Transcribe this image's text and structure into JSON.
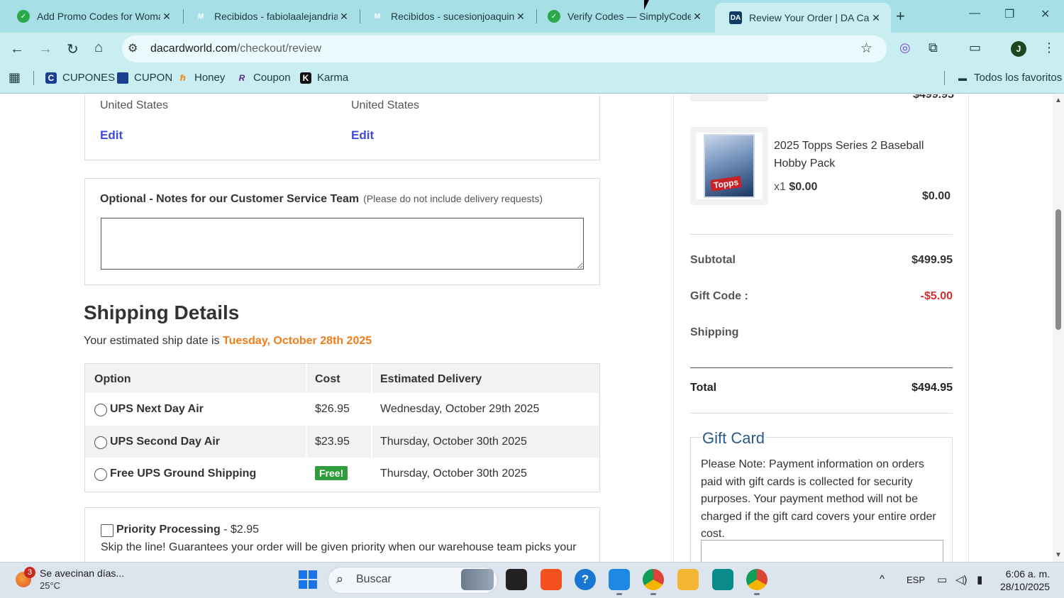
{
  "browser": {
    "tabs": [
      {
        "label": "Add Promo Codes for Woma",
        "icon": "simplycodes-icon"
      },
      {
        "label": "Recibidos - fabiolaalejandria",
        "icon": "gmail-icon"
      },
      {
        "label": "Recibidos - sucesionjoaquinh",
        "icon": "gmail-icon"
      },
      {
        "label": "Verify Codes — SimplyCodes",
        "icon": "simplycodes-icon"
      },
      {
        "label": "Review Your Order | DA Card",
        "icon": "da-icon",
        "active": true
      }
    ],
    "url_domain": "dacardworld.com",
    "url_path": "/checkout/review",
    "bookmarks": [
      {
        "label": "CUPONES"
      },
      {
        "label": "CUPON"
      },
      {
        "label": "Honey"
      },
      {
        "label": "Coupon"
      },
      {
        "label": "Karma"
      }
    ],
    "all_bookmarks": "Todos los favoritos",
    "profile_initial": "J",
    "tab_icon_texts": {
      "da": "DA",
      "gmail": "M"
    },
    "icon_glyphs": {
      "close": "✕",
      "new_tab": "+",
      "minimize": "—",
      "maximize": "❐",
      "back": "←",
      "forward": "→",
      "reload": "↻",
      "home": "⌂",
      "tune": "⚙",
      "star": "☆",
      "extension-ai": "◎",
      "puzzle": "⧉",
      "cast": "▭",
      "menu": "⋮",
      "apps-grid": "▦",
      "folder": "▬",
      "honey": "ℏ",
      "coupon": "R",
      "karma": "K",
      "cupones": "C"
    }
  },
  "addresses": {
    "billing_country": "United States",
    "shipping_country": "United States",
    "edit_label": "Edit"
  },
  "notes": {
    "title": "Optional - Notes for our Customer Service Team",
    "hint": "(Please do not include delivery requests)",
    "value": ""
  },
  "shipping": {
    "title": "Shipping Details",
    "estimate_prefix": "Your estimated ship date is",
    "estimate_date": "Tuesday, October 28th 2025",
    "headers": [
      "Option",
      "Cost",
      "Estimated Delivery"
    ],
    "options": [
      {
        "name": "UPS Next Day Air",
        "cost": "$26.95",
        "delivery": "Wednesday, October 29th 2025"
      },
      {
        "name": "UPS Second Day Air",
        "cost": "$23.95",
        "delivery": "Thursday, October 30th 2025"
      },
      {
        "name": "Free UPS Ground Shipping",
        "cost": "Free!",
        "delivery": "Thursday, October 30th 2025"
      }
    ]
  },
  "priority": {
    "title": "Priority Processing",
    "price": "- $2.95",
    "desc": "Skip the line! Guarantees your order will be given priority when our warehouse team picks your"
  },
  "order": {
    "prev_item_price": "$499.95",
    "item": {
      "name": "2025 Topps Series 2 Baseball Hobby Pack",
      "qty": "x1",
      "unit_price": "$0.00",
      "price": "$0.00",
      "logo_text": "Topps"
    },
    "summary": {
      "subtotal_label": "Subtotal",
      "subtotal": "$499.95",
      "gift_code_label": "Gift Code :",
      "gift_code": "-$5.00",
      "shipping_label": "Shipping",
      "shipping": "",
      "total_label": "Total",
      "total": "$494.95"
    }
  },
  "gift_card": {
    "title": "Gift Card",
    "note": "Please Note: Payment information on orders paid with gift cards is collected for security purposes. Your payment method will not be charged if the gift card covers your entire order cost."
  },
  "taskbar": {
    "weather_title": "Se avecinan días...",
    "weather_temp": "25°C",
    "weather_badge": "3",
    "search_placeholder": "Buscar",
    "language": "ESP",
    "time": "6:06 a. m.",
    "date": "28/10/2025",
    "glyphs": {
      "search": "⌕",
      "tray-chevron": "^",
      "network": "▭",
      "volume": "◁)",
      "battery": "▮"
    }
  },
  "colors": {
    "tabbar": "#a6e0e6",
    "toolbar": "#c8eef2",
    "link": "#3c4bd8",
    "ship_date": "#f07d1a",
    "negative": "#d62d2d",
    "free_badge": "#2f9d3b",
    "gift_title": "#2a5a8a"
  }
}
